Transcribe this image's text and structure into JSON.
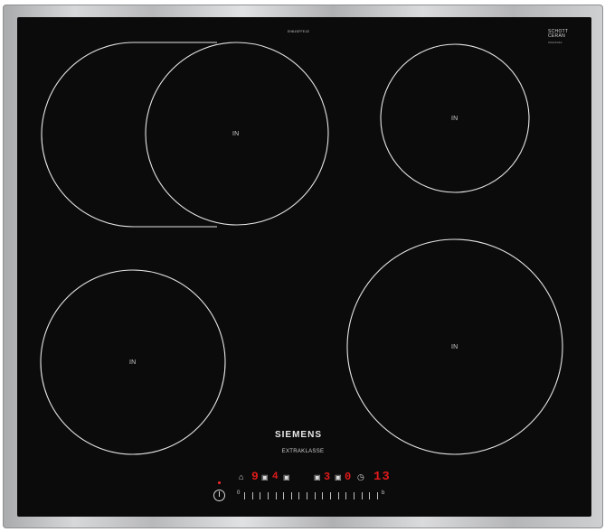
{
  "hob": {
    "model_code": "EH645FFE1E",
    "glass_brand": "SCHOTT",
    "glass_brand_sub": "CERAN",
    "glass_serial": "00029462",
    "brand": "SIEMENS",
    "series": "EXTRAKLASSE",
    "zone_label": "IN"
  },
  "display": {
    "left_digit": "9",
    "level_front": "4",
    "level_mid": "3",
    "level_right": "0",
    "timer": "13",
    "slider_min": "0",
    "slider_max": "b"
  },
  "icons": {
    "power": "power-icon",
    "cleaning": "cleaning-icon",
    "timer": "clock-icon"
  },
  "colors": {
    "glass": "#0b0b0c",
    "frame": "#c9cacb",
    "zone_line": "#e6e6e6",
    "display_red": "#e01a1a"
  }
}
